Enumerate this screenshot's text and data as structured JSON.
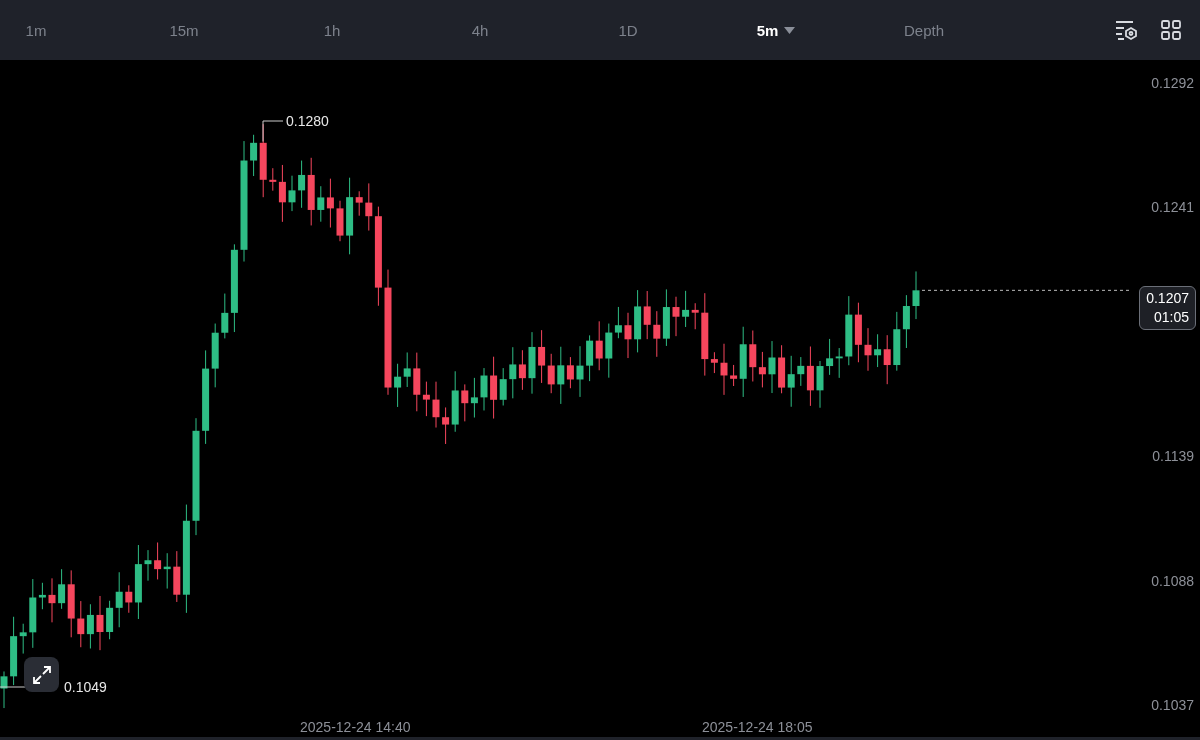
{
  "tabs": [
    {
      "label": "1m",
      "selected": false,
      "kind": "plain"
    },
    {
      "label": "15m",
      "selected": false,
      "kind": "plain"
    },
    {
      "label": "1h",
      "selected": false,
      "kind": "plain"
    },
    {
      "label": "4h",
      "selected": false,
      "kind": "plain"
    },
    {
      "label": "1D",
      "selected": false,
      "kind": "plain"
    },
    {
      "label": "5m",
      "selected": true,
      "kind": "dropdown"
    },
    {
      "label": "Depth",
      "selected": false,
      "kind": "plain"
    }
  ],
  "chart": {
    "high_label": "0.1280",
    "low_label": "0.1049",
    "y_axis_labels": [
      "0.1292",
      "0.1241",
      "0.1139",
      "0.1088",
      "0.1037"
    ],
    "price_tag": {
      "price": "0.1207",
      "countdown": "01:05"
    },
    "x_axis_labels": [
      "2025-12-24 14:40",
      "2025-12-24 18:05"
    ]
  }
}
